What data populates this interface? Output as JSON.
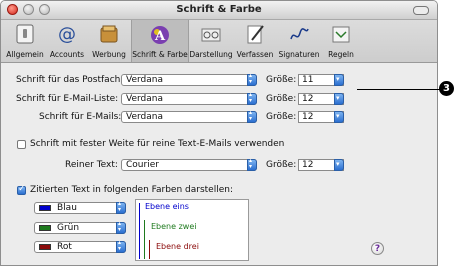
{
  "window": {
    "title": "Schrift & Farbe"
  },
  "toolbar": {
    "items": [
      {
        "label": "Allgemein",
        "icon": "switch-icon"
      },
      {
        "label": "Accounts",
        "icon": "at-icon"
      },
      {
        "label": "Werbung",
        "icon": "junk-mail-icon"
      },
      {
        "label": "Schrift & Farbe",
        "icon": "fonts-colors-icon",
        "selected": true
      },
      {
        "label": "Darstellung",
        "icon": "viewing-icon"
      },
      {
        "label": "Verfassen",
        "icon": "composing-icon"
      },
      {
        "label": "Signaturen",
        "icon": "signature-icon"
      },
      {
        "label": "Regeln",
        "icon": "rules-icon"
      }
    ]
  },
  "fonts": {
    "mailbox": {
      "label": "Schrift für das Postfach:",
      "value": "Verdana",
      "size_label": "Größe:",
      "size": "11"
    },
    "list": {
      "label": "Schrift für E-Mail-Liste:",
      "value": "Verdana",
      "size_label": "Größe:",
      "size": "12"
    },
    "message": {
      "label": "Schrift für E-Mails:",
      "value": "Verdana",
      "size_label": "Größe:",
      "size": "12"
    }
  },
  "fixed_width": {
    "checkbox_label": "Schrift mit fester Weite für reine Text-E-Mails verwenden",
    "checked": false,
    "plain_label": "Reiner Text:",
    "plain_value": "Courier",
    "size_label": "Größe:",
    "size": "12"
  },
  "quote_colors": {
    "checkbox_label": "Zitierten Text in folgenden Farben darstellen:",
    "checked": true,
    "levels": [
      {
        "color_name": "Blau",
        "color": "#0000cc",
        "preview": "Ebene eins"
      },
      {
        "color_name": "Grün",
        "color": "#1e7a1e",
        "preview": "Ebene zwei"
      },
      {
        "color_name": "Rot",
        "color": "#8b0a0a",
        "preview": "Ebene drei"
      }
    ]
  },
  "callout": {
    "number": "3"
  }
}
